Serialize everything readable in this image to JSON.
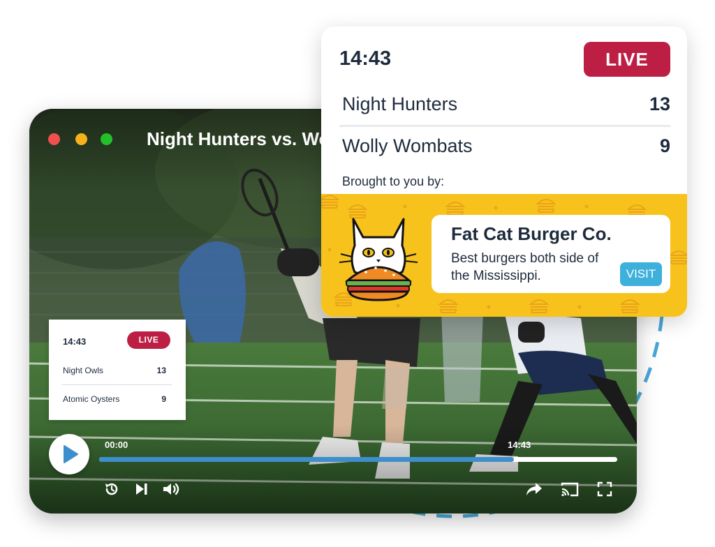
{
  "colors": {
    "live_red": "#bd1f44",
    "progress_blue": "#3d8fcb",
    "visit_blue": "#3db0dc",
    "ad_yellow": "#f7c21b",
    "text_navy": "#1e2b3c"
  },
  "player": {
    "title": "Night Hunters vs. Wolly Wombats",
    "time_start": "00:00",
    "time_current": "14:43",
    "progress_fraction": 0.8,
    "icons": [
      "play-icon",
      "replay-icon",
      "skip-next-icon",
      "volume-icon",
      "share-icon",
      "cast-icon",
      "fullscreen-icon"
    ]
  },
  "mini_board": {
    "clock": "14:43",
    "live_label": "LIVE",
    "teams": [
      {
        "name": "Night Owls",
        "score": "13"
      },
      {
        "name": "Atomic Oysters",
        "score": "9"
      }
    ]
  },
  "score_card": {
    "clock": "14:43",
    "live_label": "LIVE",
    "teams": [
      {
        "name": "Night Hunters",
        "score": "13"
      },
      {
        "name": "Wolly Wombats",
        "score": "9"
      }
    ],
    "sponsor_label": "Brought to you by:"
  },
  "ad": {
    "brand": "Fat Cat Burger Co.",
    "tagline": "Best burgers both side of the Mississippi.",
    "cta": "VISIT"
  }
}
